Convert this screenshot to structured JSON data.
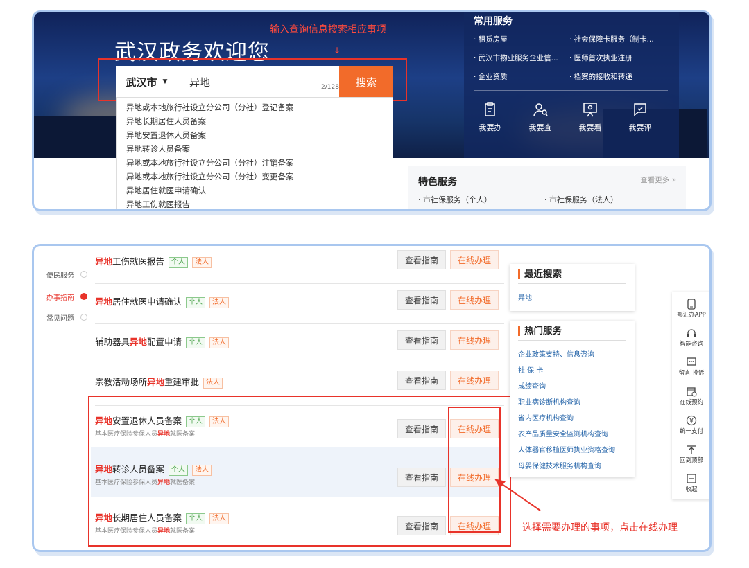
{
  "top": {
    "welcome": "武汉政务欢迎您",
    "hint": "输入查询信息搜索相应事项",
    "hint_arrow": "↓",
    "city": "武汉市",
    "search_value": "异地",
    "counter": "2/128",
    "search_button": "搜索",
    "suggestions": [
      "异地或本地旅行社设立分公司（分社）登记备案",
      "异地长期居住人员备案",
      "异地安置退休人员备案",
      "异地转诊人员备案",
      "异地或本地旅行社设立分公司（分社）注销备案",
      "异地或本地旅行社设立分公司（分社）变更备案",
      "异地居住就医申请确认",
      "异地工伤就医报告"
    ],
    "common_services": {
      "title": "常用服务",
      "items": [
        "· 租赁房屋",
        "· 社会保障卡服务（制卡...",
        "· 武汉市物业服务企业信...",
        "· 医师首次执业注册",
        "· 企业资质",
        "· 档案的接收和转递"
      ],
      "actions": [
        "我要办",
        "我要查",
        "我要看",
        "我要评"
      ]
    },
    "featured": {
      "title": "特色服务",
      "more": "查看更多 »",
      "items": [
        "· 市社保服务（个人）",
        "· 市社保服务（法人）"
      ]
    }
  },
  "list": {
    "side_nav": [
      "便民服务",
      "办事指南",
      "常见问题"
    ],
    "guide_label": "查看指南",
    "online_label": "在线办理",
    "personal_tag": "个人",
    "legal_tag": "法人",
    "rows": [
      {
        "pre": "",
        "hl": "异地",
        "post": "工伤就医报告",
        "sub_pre": "",
        "sub_hl": "",
        "sub_post": ""
      },
      {
        "pre": "",
        "hl": "异地",
        "post": "居住就医申请确认",
        "sub_pre": "",
        "sub_hl": "",
        "sub_post": ""
      },
      {
        "pre": "辅助器具",
        "hl": "异地",
        "post": "配置申请",
        "sub_pre": "",
        "sub_hl": "",
        "sub_post": ""
      },
      {
        "pre": "宗教活动场所",
        "hl": "异地",
        "post": "重建审批",
        "sub_pre": "",
        "sub_hl": "",
        "sub_post": ""
      },
      {
        "pre": "",
        "hl": "异地",
        "post": "安置退休人员备案",
        "sub_pre": "基本医疗保险参保人员",
        "sub_hl": "异地",
        "sub_post": "就医备案"
      },
      {
        "pre": "",
        "hl": "异地",
        "post": "转诊人员备案",
        "sub_pre": "基本医疗保险参保人员",
        "sub_hl": "异地",
        "sub_post": "就医备案"
      },
      {
        "pre": "",
        "hl": "异地",
        "post": "长期居住人员备案",
        "sub_pre": "基本医疗保险参保人员",
        "sub_hl": "异地",
        "sub_post": "就医备案"
      }
    ],
    "recent": {
      "title": "最近搜索",
      "items": [
        "异地"
      ]
    },
    "hot": {
      "title": "热门服务",
      "items": [
        "企业政策支持、信息咨询",
        "社 保 卡",
        "成绩查询",
        "职业病诊断机构查询",
        "省内医疗机构查询",
        "农产品质量安全监测机构查询",
        "人体器官移植医师执业资格查询",
        "母婴保健技术服务机构查询"
      ]
    },
    "toolbar": [
      "鄂汇办APP",
      "智能咨询",
      "留言 投诉",
      "在线预约",
      "统一支付",
      "回到顶部",
      "收起"
    ],
    "note": "选择需要办理的事项，点击在线办理"
  },
  "colors": {
    "accent": "#f26b2a",
    "annotation": "#e8332a",
    "link": "#2363a8",
    "hero": "#1d3f86"
  }
}
